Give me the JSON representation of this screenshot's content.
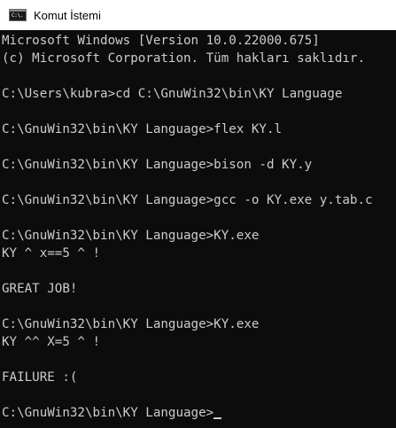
{
  "window": {
    "title": "Komut İstemi",
    "icon_label": "C:\\.",
    "icon_name": "cmd-icon"
  },
  "console": {
    "lines": [
      "Microsoft Windows [Version 10.0.22000.675]",
      "(c) Microsoft Corporation. Tüm hakları saklıdır.",
      "",
      "C:\\Users\\kubra>cd C:\\GnuWin32\\bin\\KY Language",
      "",
      "C:\\GnuWin32\\bin\\KY Language>flex KY.l",
      "",
      "C:\\GnuWin32\\bin\\KY Language>bison -d KY.y",
      "",
      "C:\\GnuWin32\\bin\\KY Language>gcc -o KY.exe y.tab.c",
      "",
      "C:\\GnuWin32\\bin\\KY Language>KY.exe",
      "KY ^ x==5 ^ !",
      "",
      "GREAT JOB!",
      "",
      "C:\\GnuWin32\\bin\\KY Language>KY.exe",
      "KY ^^ X=5 ^ !",
      "",
      "FAILURE :(",
      "",
      "C:\\GnuWin32\\bin\\KY Language>"
    ]
  },
  "colors": {
    "background": "#0c0c0c",
    "text": "#cccccc",
    "titlebar": "#ffffff"
  }
}
